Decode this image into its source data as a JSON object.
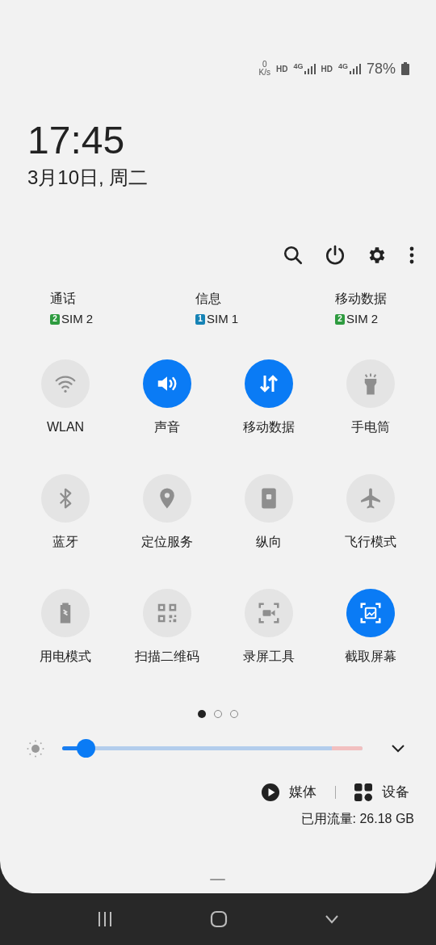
{
  "status_bar": {
    "speed_value": "0",
    "speed_unit": "K/s",
    "sim1_hd": "HD",
    "sim1_network": "4G",
    "sim2_hd": "HD",
    "sim2_network": "4G",
    "battery": "78%"
  },
  "clock": {
    "time": "17:45",
    "date": "3月10日, 周二"
  },
  "sim_defaults": [
    {
      "label": "通话",
      "sim_number": "2",
      "sim": "SIM 2",
      "color": "#2e9b3f"
    },
    {
      "label": "信息",
      "sim_number": "1",
      "sim": "SIM 1",
      "color": "#1683b5"
    },
    {
      "label": "移动数据",
      "sim_number": "2",
      "sim": "SIM 2",
      "color": "#2e9b3f"
    }
  ],
  "tiles": [
    {
      "label": "WLAN",
      "on": false
    },
    {
      "label": "声音",
      "on": true
    },
    {
      "label": "移动数据",
      "on": true
    },
    {
      "label": "手电筒",
      "on": false
    },
    {
      "label": "蓝牙",
      "on": false
    },
    {
      "label": "定位服务",
      "on": false
    },
    {
      "label": "纵向",
      "on": false
    },
    {
      "label": "飞行模式",
      "on": false
    },
    {
      "label": "用电模式",
      "on": false
    },
    {
      "label": "扫描二维码",
      "on": false
    },
    {
      "label": "录屏工具",
      "on": false
    },
    {
      "label": "截取屏幕",
      "on": true
    }
  ],
  "pages": [
    {
      "selected": true
    },
    {
      "selected": false
    },
    {
      "selected": false
    }
  ],
  "brightness": {
    "level": 0.08
  },
  "media_button": "媒体",
  "devices_button": "设备",
  "data_usage": "已用流量: 26.18 GB"
}
